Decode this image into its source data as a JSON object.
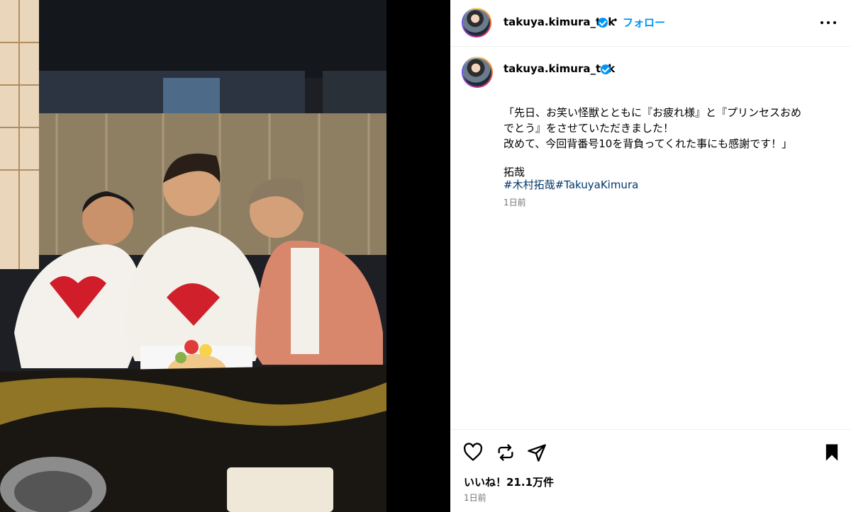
{
  "post": {
    "username": "takuya.kimura_tak",
    "follow_label": "フォロー",
    "separator": "•",
    "photo_description_icon": "photo",
    "caption": "「先日、お笑い怪獣とともに『お疲れ様』と『プリンセスおめ\nでとう』をさせていただきました！\n改めて、今回背番号10を背負ってくれた事にも感謝です！」",
    "caption_sign": "拓哉",
    "hashtags": [
      "#木村拓哉",
      "#TakuyaKimura"
    ],
    "comment_time": "1日前",
    "likes_label": "いいね！21.1万件",
    "post_time": "1日前"
  },
  "icons": {
    "more": "more-horizontal-icon",
    "like": "heart-icon",
    "repost": "repost-icon",
    "share": "share-icon",
    "save": "bookmark-icon"
  },
  "colors": {
    "follow": "#0095f6",
    "verified": "#0095f6",
    "hashtag": "#00376b",
    "muted": "#737373"
  }
}
